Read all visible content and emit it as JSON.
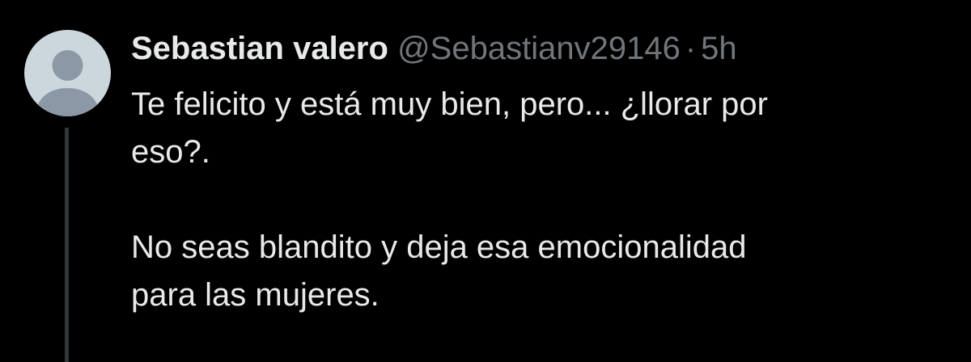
{
  "tweet": {
    "author_name": "Sebastian valero",
    "handle": "@Sebastianv29146",
    "separator": "·",
    "time": "5h",
    "paragraphs": [
      {
        "lines": [
          "Te felicito y está muy bien, pero... ¿llorar por",
          "eso?."
        ]
      },
      {
        "lines": [
          "No seas blandito y deja esa emocionalidad",
          "para las mujeres."
        ]
      }
    ]
  },
  "avatar": {
    "icon": "default-user-avatar-icon"
  },
  "colors": {
    "background": "#000000",
    "text_primary": "#e7e9ea",
    "text_secondary": "#71767b",
    "avatar_bg": "#ccd6dd",
    "avatar_figure": "#8b98a5",
    "thread_line": "#333639"
  }
}
